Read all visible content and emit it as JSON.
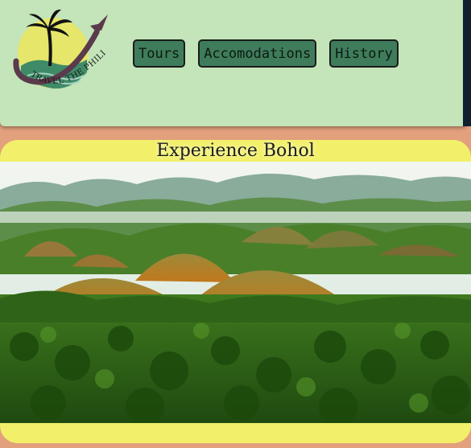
{
  "logo": {
    "text": "TRAVEL THE PHILIPPINES",
    "icon": "palm-tree-airplane-logo"
  },
  "nav": {
    "items": [
      {
        "label": "Tours"
      },
      {
        "label": "Accomodations"
      },
      {
        "label": "History"
      }
    ]
  },
  "hero": {
    "title": "Experience Bohol",
    "image_description": "chocolate-hills-landscape"
  },
  "colors": {
    "page_bg": "#e2a07c",
    "header_bg": "#c3e5b9",
    "button_bg": "#3f7c5c",
    "card_bg": "#f2f06a"
  }
}
